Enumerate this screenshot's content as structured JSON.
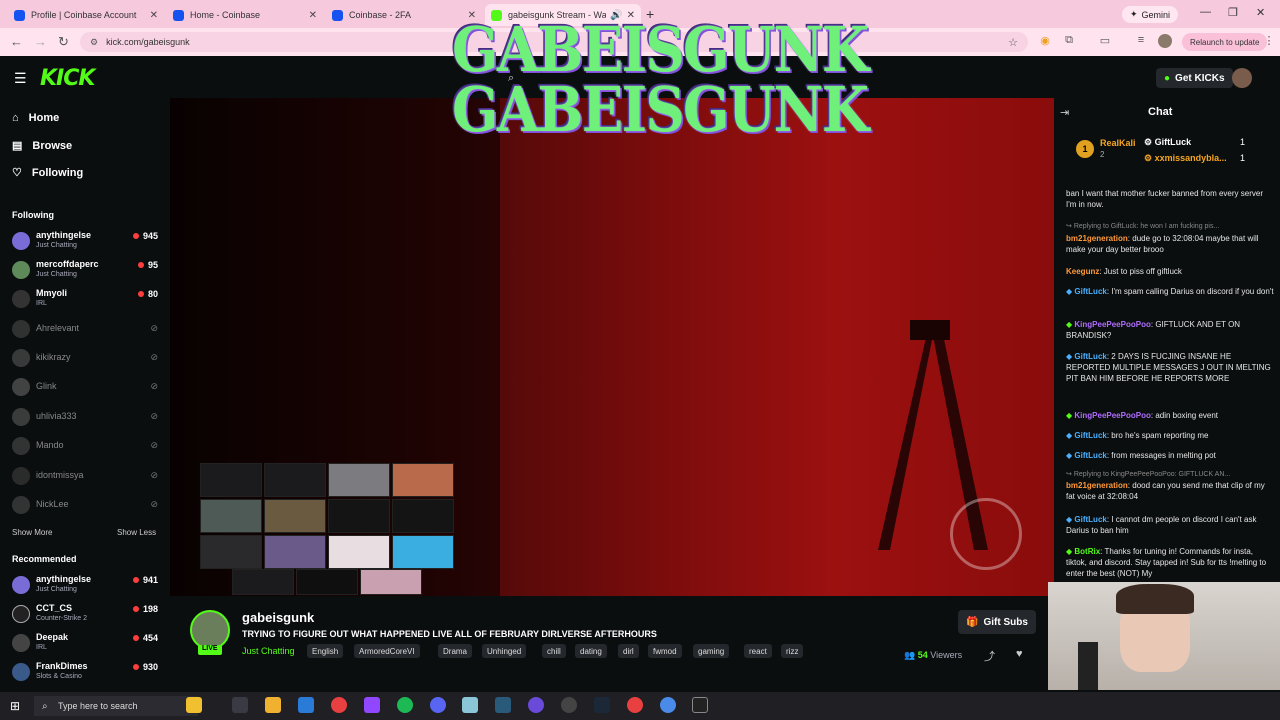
{
  "browser": {
    "tabs": [
      {
        "label": "Profile | Coinbase Account",
        "color": "#1652f0"
      },
      {
        "label": "Home - Coinbase",
        "color": "#1652f0"
      },
      {
        "label": "Coinbase - 2FA",
        "color": "#1652f0"
      },
      {
        "label": "gabeisgunk Stream - Watc",
        "color": "#53fc18"
      }
    ],
    "gemini_label": "Gemini",
    "url": "kick.com/gabeisgunk",
    "relaunch_label": "Relaunch to update"
  },
  "kick": {
    "logo": "KICK",
    "get_kicks": "Get KICKs"
  },
  "overlay_text": [
    "GABEISGUNK",
    "GABEISGUNK"
  ],
  "sidebar": {
    "nav": [
      {
        "label": "Home",
        "icon": "home-icon"
      },
      {
        "label": "Browse",
        "icon": "browse-icon"
      },
      {
        "label": "Following",
        "icon": "heart-icon"
      }
    ],
    "following_header": "Following",
    "following": [
      {
        "name": "anythingelse",
        "category": "Just Chatting",
        "viewers": "945",
        "live": true,
        "color": "#7a6cd6"
      },
      {
        "name": "mercoffdaperc",
        "category": "Just Chatting",
        "viewers": "95",
        "live": true,
        "color": "#5e8a5a"
      },
      {
        "name": "Mmyoli",
        "category": "IRL",
        "viewers": "80",
        "live": true,
        "color": "#333"
      },
      {
        "name": "Ahrelevant",
        "live": false,
        "color": "#555"
      },
      {
        "name": "kikikrazy",
        "live": false,
        "color": "#666"
      },
      {
        "name": "Glink",
        "live": false,
        "color": "#777"
      },
      {
        "name": "uhlivia333",
        "live": false,
        "color": "#6a6a6a"
      },
      {
        "name": "Mando",
        "live": false,
        "color": "#5a5a5a"
      },
      {
        "name": "idontmissya",
        "live": false,
        "color": "#4a4a4a"
      },
      {
        "name": "NickLee",
        "live": false,
        "color": "#5a5a5a"
      }
    ],
    "show_more": "Show More",
    "show_less": "Show Less",
    "recommended_header": "Recommended",
    "recommended": [
      {
        "name": "anythingelse",
        "category": "Just Chatting",
        "viewers": "941",
        "color": "#7a6cd6"
      },
      {
        "name": "CCT_CS",
        "category": "Counter-Strike 2",
        "viewers": "198",
        "color": "#222"
      },
      {
        "name": "Deepak",
        "category": "IRL",
        "viewers": "454",
        "color": "#444"
      },
      {
        "name": "FrankDimes",
        "category": "Slots & Casino",
        "viewers": "930",
        "color": "#3a5a8a"
      }
    ]
  },
  "stream": {
    "live_badge": "LIVE",
    "name": "gabeisgunk",
    "title": "TRYING TO FIGURE OUT WHAT HAPPENED  LIVE ALL OF FEBRUARY DIRLVERSE AFTERHOURS",
    "category": "Just Chatting",
    "tags": [
      "English",
      "ArmoredCoreVI",
      "Drama",
      "Unhinged",
      "chill",
      "dating",
      "dirl",
      "fwmod",
      "gaming",
      "react",
      "rizz"
    ],
    "gift_subs": "Gift Subs",
    "viewers_count": "54",
    "viewers_label": "Viewers"
  },
  "chat": {
    "title": "Chat",
    "leaderboard": [
      {
        "rank": "1",
        "name": "RealKali",
        "value": "2"
      },
      {
        "name": "GiftLuck",
        "value": "1"
      },
      {
        "name": "xxmissandybla...",
        "value": "1"
      }
    ],
    "messages": [
      {
        "type": "text",
        "text": "ban I want that mother fucker banned from every server I'm in now."
      },
      {
        "type": "reply",
        "text": "Replying to GiftLuck: he won I am fucking pis..."
      },
      {
        "type": "msg",
        "user": "bm21generation",
        "color": "#ff9a3c",
        "text": "dude go to 32:08:04 maybe that will make your day better brooo"
      },
      {
        "type": "msg",
        "user": "Keegunz",
        "color": "#ff9a3c",
        "text": "Just to piss off giftluck"
      },
      {
        "type": "msg",
        "user": "GiftLuck",
        "color": "#4ab0ff",
        "text": "I'm spam calling Darius on discord if you don't"
      },
      {
        "type": "msg",
        "user": "KingPeePeePooPoo",
        "color": "#b06cff",
        "text": "GIFTLUCK AND ET ON BRANDISK?"
      },
      {
        "type": "msg",
        "user": "GiftLuck",
        "color": "#4ab0ff",
        "text": "2 DAYS IS FUCJING INSANE HE REPORTED MULTIPLE MESSAGES J OUT IN MELTING PIT BAN HIM BEFORE HE REPORTS MORE"
      },
      {
        "type": "msg",
        "user": "KingPeePeePooPoo",
        "color": "#b06cff",
        "text": "adin boxing event"
      },
      {
        "type": "msg",
        "user": "GiftLuck",
        "color": "#4ab0ff",
        "text": "bro he's spam reporting me"
      },
      {
        "type": "msg",
        "user": "GiftLuck",
        "color": "#4ab0ff",
        "text": "from messages in melting pot"
      },
      {
        "type": "reply",
        "text": "Replying to KingPeePeePooPoo: GIFTLUCK AN..."
      },
      {
        "type": "msg",
        "user": "bm21generation",
        "color": "#ff9a3c",
        "text": "dood can you send me that clip of my fat voice at 32:08:04"
      },
      {
        "type": "msg",
        "user": "GiftLuck",
        "color": "#4ab0ff",
        "text": "I cannot dm people on discord I can't ask Darius to ban him"
      },
      {
        "type": "msg",
        "user": "BotRix",
        "color": "#53fc18",
        "text": "Thanks for tuning in! Commands for insta, tiktok, and discord. Stay tapped in! Sub for tts !melting to enter the best (NOT) My"
      }
    ]
  },
  "taskbar": {
    "search_placeholder": "Type here to search"
  }
}
